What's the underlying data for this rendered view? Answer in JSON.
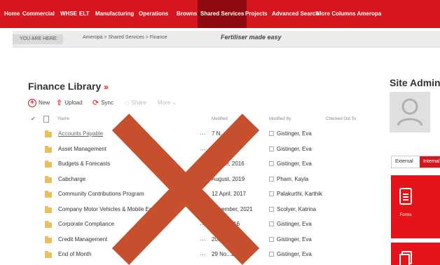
{
  "nav": {
    "items": [
      "Home",
      "Commercial",
      "WHSE",
      "ELT",
      "Manufacturing",
      "Operations",
      "Browns",
      "Shared Services",
      "Projects",
      "Advanced Search",
      "More Columns Ameropa"
    ],
    "active": "Shared Services"
  },
  "breadcrumb": {
    "you_are_here": "YOU ARE HERE:",
    "path": "Ameropa > Shared Services > Finance",
    "tagline": "Fertiliser made easy"
  },
  "library": {
    "title": "Finance Library",
    "toolbar": {
      "new": "New",
      "upload": "Upload",
      "sync": "Sync",
      "share": "Share",
      "more": "More"
    },
    "columns": {
      "name": "Name",
      "modified": "Modified",
      "modified_by": "Modified By",
      "checked_out_to": "Checked Out To"
    },
    "rows": [
      {
        "name": "Accounts Payable",
        "modified": "7 N...016",
        "modified_by": "Gistinger, Eva"
      },
      {
        "name": "Asset Management",
        "modified": "..., 2016",
        "modified_by": "Gistinger, Eva"
      },
      {
        "name": "Budgets & Forecasts",
        "modified": "...mber, 2016",
        "modified_by": "Gistinger, Eva"
      },
      {
        "name": "Cabcharge",
        "modified": "August, 2019",
        "modified_by": "Pham, Kayla"
      },
      {
        "name": "Community Contributions Program",
        "modified": "12 April, 2017",
        "modified_by": "Palakurthi, Karthik"
      },
      {
        "name": "Company Motor Vehicles & Mobile Eq...",
        "modified": "November, 2021",
        "modified_by": "Scolyer, Katrina"
      },
      {
        "name": "Corporate Compliance",
        "modified": "...ber, 2016",
        "modified_by": "Gistinger, Eva"
      },
      {
        "name": "Credit Management",
        "modified": "2016",
        "modified_by": "Gistinger, Eva"
      },
      {
        "name": "End of Month",
        "modified": "29 No...2016",
        "modified_by": "Gistinger, Eva"
      }
    ]
  },
  "sidebar": {
    "title": "Site Admin",
    "tabs": [
      "External",
      "Internal"
    ],
    "tiles": [
      {
        "label": "Forms"
      },
      {
        "label": ""
      }
    ]
  },
  "colors": {
    "brand_red": "#d7171f",
    "active_nav": "#8e0a10",
    "overlay_x": "#c6502e"
  }
}
